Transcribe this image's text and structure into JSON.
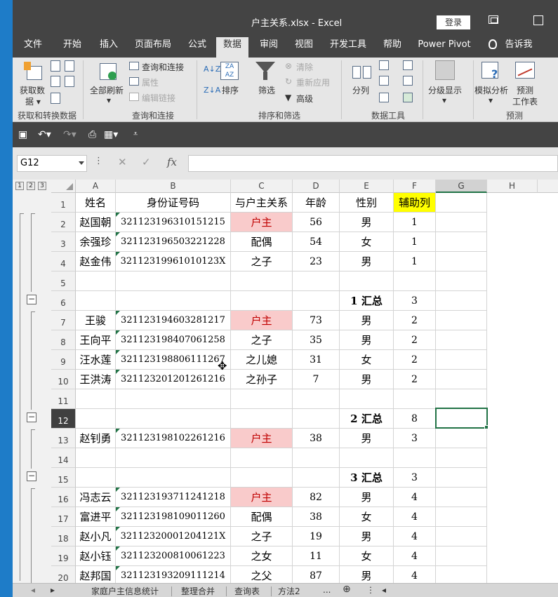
{
  "window": {
    "title": "户主关系.xlsx  -  Excel",
    "login_label": "登录"
  },
  "menu_tabs": [
    "文件",
    "开始",
    "插入",
    "页面布局",
    "公式",
    "数据",
    "审阅",
    "视图",
    "开发工具",
    "帮助",
    "Power Pivot",
    "告诉我"
  ],
  "active_tab": "数据",
  "ribbon": {
    "get_data_line1": "获取数",
    "get_data_line2": "据",
    "refresh_all": "全部刷新",
    "queries_connections": "查询和连接",
    "properties": "属性",
    "edit_links": "编辑链接",
    "sort": "排序",
    "filter": "筛选",
    "clear": "清除",
    "reapply": "重新应用",
    "advanced": "高级",
    "text_to_columns": "分列",
    "outline": "分级显示",
    "what_if_analysis": "模拟分析",
    "forecast_sheet_line1": "预测",
    "forecast_sheet_line2": "工作表",
    "groups": {
      "get_transform": "获取和转换数据",
      "queries": "查询和连接",
      "sort_filter": "排序和筛选",
      "data_tools": "数据工具",
      "forecast": "预测"
    }
  },
  "name_box": "G12",
  "formula_bar": {
    "fx_label": "fx",
    "value": ""
  },
  "outline_levels": [
    "1",
    "2",
    "3"
  ],
  "columns": [
    "A",
    "B",
    "C",
    "D",
    "E",
    "F",
    "G",
    "H"
  ],
  "selected_column": "G",
  "selected_row": "12",
  "selected_cell": "G12",
  "header_row": [
    "姓名",
    "身份证号码",
    "与户主关系",
    "年龄",
    "性别",
    "辅助列"
  ],
  "rows": [
    {
      "n": "2",
      "name": "赵国朝",
      "id": "321123196310151215",
      "rel": "户主",
      "age": "56",
      "sex": "男",
      "aux": "1"
    },
    {
      "n": "3",
      "name": "余强珍",
      "id": "321123196503221228",
      "rel": "配偶",
      "age": "54",
      "sex": "女",
      "aux": "1"
    },
    {
      "n": "4",
      "name": "赵金伟",
      "id": "32112319961010123X",
      "rel": "之子",
      "age": "23",
      "sex": "男",
      "aux": "1"
    },
    {
      "n": "5",
      "name": "",
      "id": "",
      "rel": "",
      "age": "",
      "sex": "",
      "aux": ""
    },
    {
      "n": "6",
      "name": "",
      "id": "",
      "rel": "",
      "age": "",
      "sex": "1 汇总",
      "aux": "3"
    },
    {
      "n": "7",
      "name": "王骏",
      "id": "321123194603281217",
      "rel": "户主",
      "age": "73",
      "sex": "男",
      "aux": "2"
    },
    {
      "n": "8",
      "name": "王向平",
      "id": "321123198407061258",
      "rel": "之子",
      "age": "35",
      "sex": "男",
      "aux": "2"
    },
    {
      "n": "9",
      "name": "汪水莲",
      "id": "321123198806111267",
      "rel": "之儿媳",
      "age": "31",
      "sex": "女",
      "aux": "2"
    },
    {
      "n": "10",
      "name": "王洪涛",
      "id": "321123201201261216",
      "rel": "之孙子",
      "age": "7",
      "sex": "男",
      "aux": "2"
    },
    {
      "n": "11",
      "name": "",
      "id": "",
      "rel": "",
      "age": "",
      "sex": "",
      "aux": ""
    },
    {
      "n": "12",
      "name": "",
      "id": "",
      "rel": "",
      "age": "",
      "sex": "2 汇总",
      "aux": "8"
    },
    {
      "n": "13",
      "name": "赵钊勇",
      "id": "321123198102261216",
      "rel": "户主",
      "age": "38",
      "sex": "男",
      "aux": "3"
    },
    {
      "n": "14",
      "name": "",
      "id": "",
      "rel": "",
      "age": "",
      "sex": "",
      "aux": ""
    },
    {
      "n": "15",
      "name": "",
      "id": "",
      "rel": "",
      "age": "",
      "sex": "3 汇总",
      "aux": "3"
    },
    {
      "n": "16",
      "name": "冯志云",
      "id": "321123193711241218",
      "rel": "户主",
      "age": "82",
      "sex": "男",
      "aux": "4"
    },
    {
      "n": "17",
      "name": "富进平",
      "id": "321123198109011260",
      "rel": "配偶",
      "age": "38",
      "sex": "女",
      "aux": "4"
    },
    {
      "n": "18",
      "name": "赵小凡",
      "id": "32112320001204121X",
      "rel": "之子",
      "age": "19",
      "sex": "男",
      "aux": "4"
    },
    {
      "n": "19",
      "name": "赵小钰",
      "id": "321123200810061223",
      "rel": "之女",
      "age": "11",
      "sex": "女",
      "aux": "4"
    },
    {
      "n": "20",
      "name": "赵邦国",
      "id": "321123193209111214",
      "rel": "之父",
      "age": "87",
      "sex": "男",
      "aux": "4"
    }
  ],
  "sheet_tabs": [
    "家庭户主信息统计",
    "整理合并",
    "查询表",
    "方法2",
    "..."
  ],
  "colors": {
    "excel_green": "#217346",
    "householder_fill": "#f9cbcb",
    "householder_text": "#c00000",
    "aux_header_fill": "#ffff00"
  }
}
